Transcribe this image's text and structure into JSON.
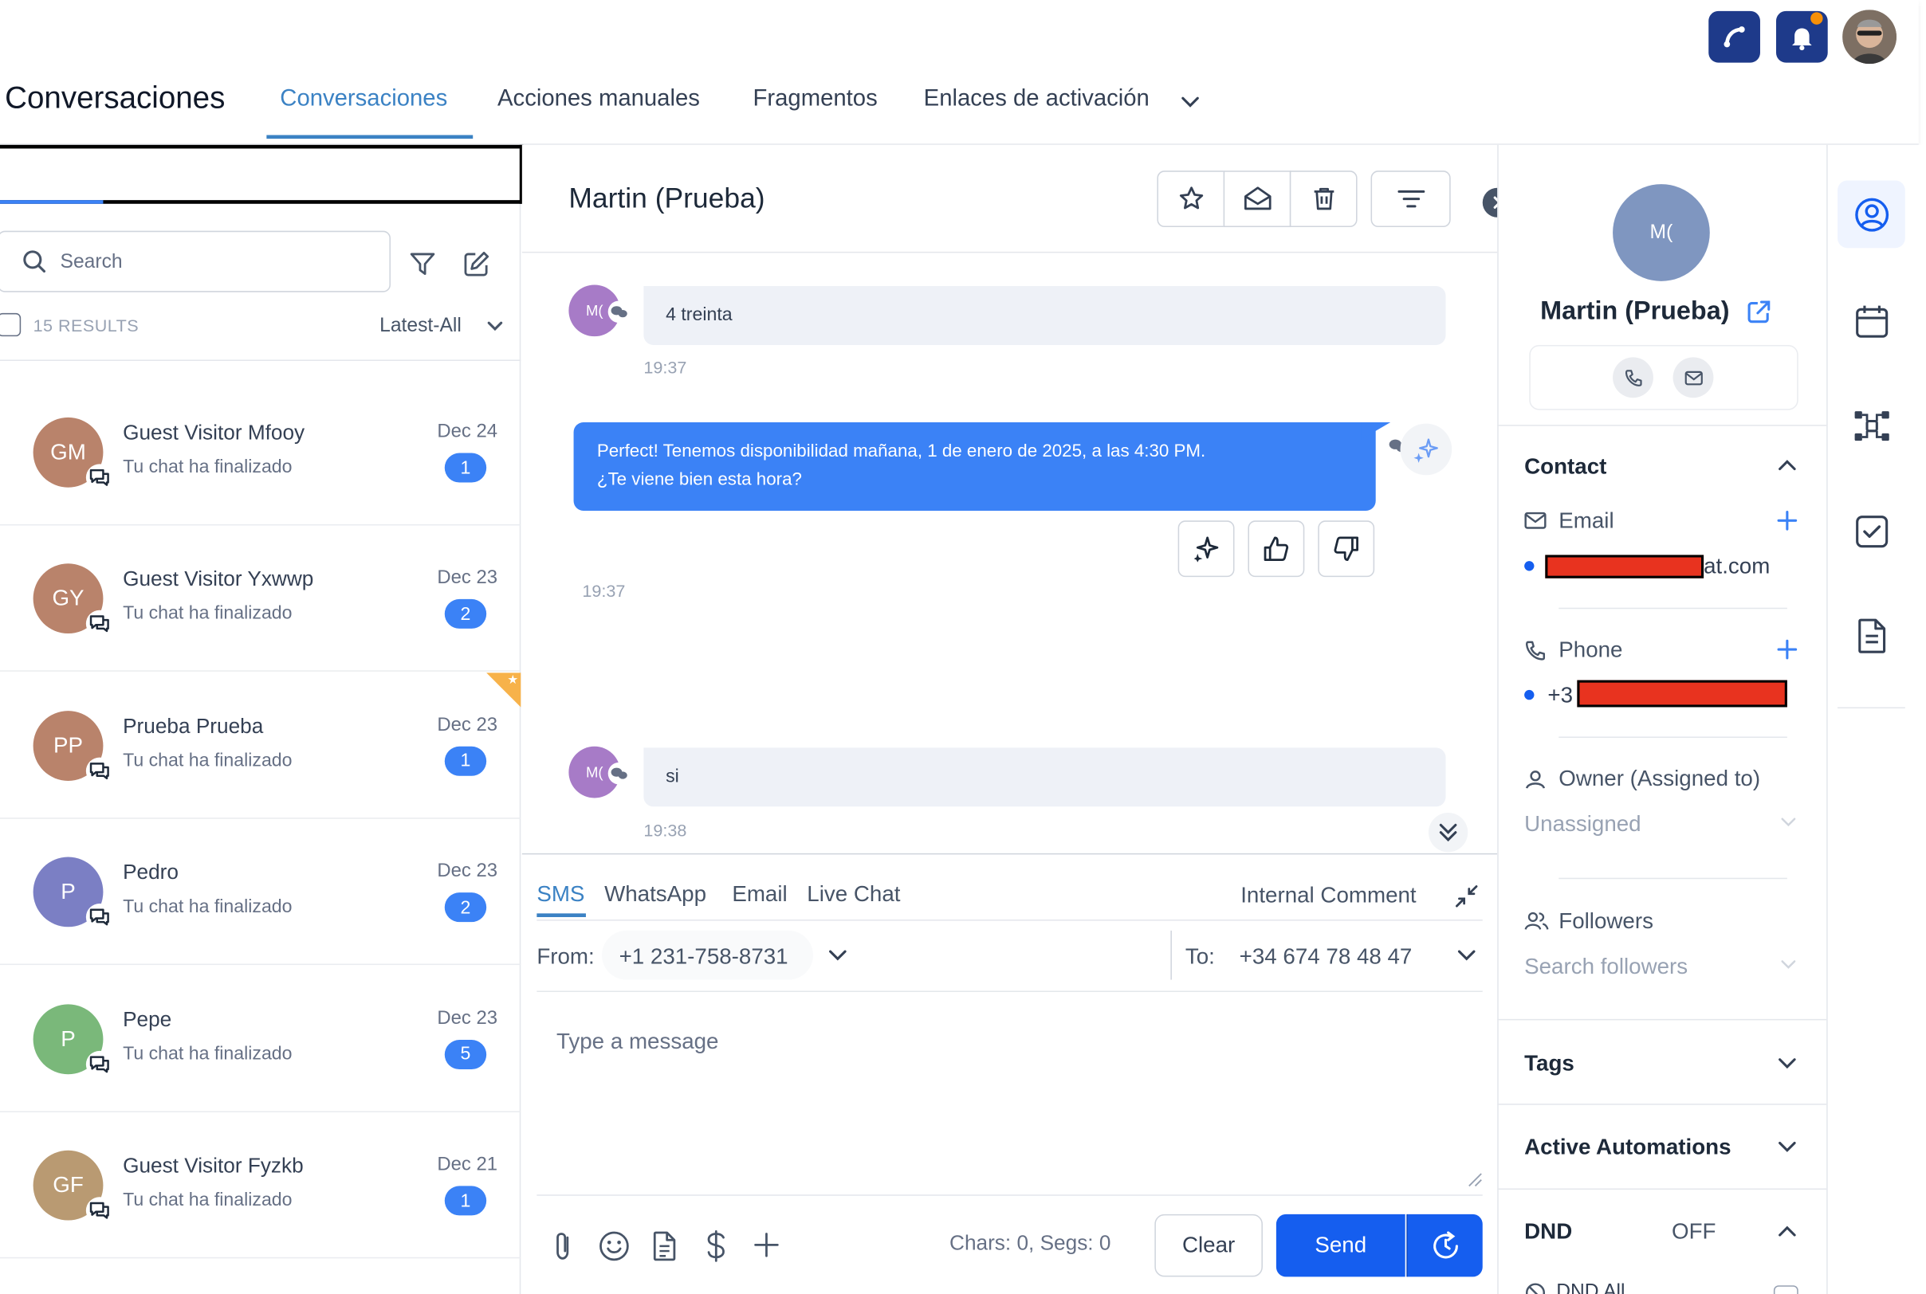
{
  "header": {
    "title": "Conversaciones",
    "tabs": [
      {
        "label": "Conversaciones",
        "active": true
      },
      {
        "label": "Acciones manuales"
      },
      {
        "label": "Fragmentos"
      },
      {
        "label": "Enlaces de activación"
      }
    ],
    "accent": "#1e3a8a"
  },
  "list": {
    "search_placeholder": "Search",
    "results": "15 RESULTS",
    "sort": "Latest-All",
    "items": [
      {
        "initials": "GM",
        "name": "Guest Visitor Mfooy",
        "preview": "Tu chat ha finalizado",
        "date": "Dec 24",
        "count": "1",
        "color": "#b9836b"
      },
      {
        "initials": "GY",
        "name": "Guest Visitor Yxwwp",
        "preview": "Tu chat ha finalizado",
        "date": "Dec 23",
        "count": "2",
        "color": "#b9836b"
      },
      {
        "initials": "PP",
        "name": "Prueba Prueba",
        "preview": "Tu chat ha finalizado",
        "date": "Dec 23",
        "count": "1",
        "color": "#b9836b"
      },
      {
        "initials": "P",
        "name": "Pedro",
        "preview": "Tu chat ha finalizado",
        "date": "Dec 23",
        "count": "2",
        "color": "#7b7fc4"
      },
      {
        "initials": "P",
        "name": "Pepe",
        "preview": "Tu chat ha finalizado",
        "date": "Dec 23",
        "count": "5",
        "color": "#7ab87a"
      },
      {
        "initials": "GF",
        "name": "Guest Visitor Fyzkb",
        "preview": "Tu chat ha finalizado",
        "date": "Dec 21",
        "count": "1",
        "color": "#b99a72"
      }
    ]
  },
  "chat": {
    "contact_name": "Martin (Prueba)",
    "avatar_initials": "M(",
    "messages": [
      {
        "direction": "in",
        "text": "4 treinta",
        "time": "19:37"
      },
      {
        "direction": "out",
        "text_line1": "Perfect! Tenemos disponibilidad mañana, 1 de enero de 2025, a las 4:30 PM.",
        "text_line2": "¿Te viene bien esta hora?",
        "time": "19:37"
      },
      {
        "direction": "in",
        "text": "si",
        "time": "19:38"
      }
    ]
  },
  "composer": {
    "channels": [
      "SMS",
      "WhatsApp",
      "Email",
      "Live Chat"
    ],
    "active_channel": "SMS",
    "internal_comment": "Internal Comment",
    "from_label": "From:",
    "from_value": "+1 231-758-8731",
    "to_label": "To:",
    "to_value": "+34 674 78 48 47",
    "placeholder": "Type a message",
    "chars": "Chars: 0, Segs: 0",
    "clear_label": "Clear",
    "send_label": "Send",
    "send_color": "#155eef"
  },
  "contact": {
    "initials": "M(",
    "name": "Martin (Prueba)",
    "section_contact": "Contact",
    "email_label": "Email",
    "email_suffix": "at.com",
    "phone_label": "Phone",
    "phone_prefix": "+3",
    "owner_label": "Owner (Assigned to)",
    "owner_value": "Unassigned",
    "followers_label": "Followers",
    "followers_placeholder": "Search followers",
    "tags_label": "Tags",
    "automations_label": "Active Automations",
    "dnd_label": "DND",
    "dnd_value": "OFF",
    "dnd_all": "DND All"
  }
}
